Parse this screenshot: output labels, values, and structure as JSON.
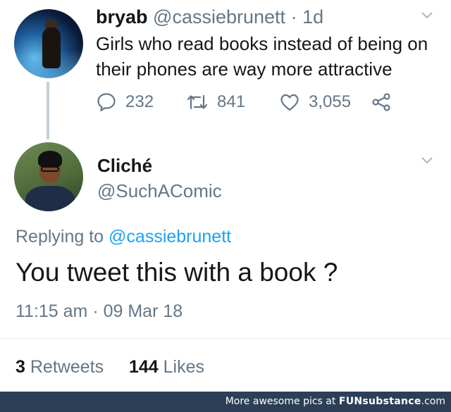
{
  "original_tweet": {
    "display_name": "bryab",
    "handle": "@cassiebrunett",
    "separator": "·",
    "age": "1d",
    "text": "Girls who read books instead of being on their phones are way more attractive",
    "replies": "232",
    "retweets": "841",
    "likes": "3,055"
  },
  "reply_tweet": {
    "display_name": "Cliché",
    "handle": "@SuchAComic",
    "replying_prefix": "Replying to",
    "replying_mention": "@cassiebrunett",
    "text": "You tweet this with a book ?",
    "timestamp": "11:15 am · 09 Mar 18",
    "retweet_count": "3",
    "retweet_label": "Retweets",
    "like_count": "144",
    "like_label": "Likes"
  },
  "watermark": {
    "prefix": "More awesome pics at",
    "logo": "FUNsubstance",
    "suffix": ".com"
  },
  "colors": {
    "text": "#14171a",
    "muted": "#657786",
    "link": "#1da1f2",
    "thread_line": "#c4cfd6",
    "watermark_bar": "#2c3f57"
  },
  "icons": {
    "reply": "speech-bubble-icon",
    "retweet": "retweet-arrows-icon",
    "like": "heart-outline-icon",
    "share": "share-nodes-icon",
    "menu": "chevron-down-icon"
  }
}
